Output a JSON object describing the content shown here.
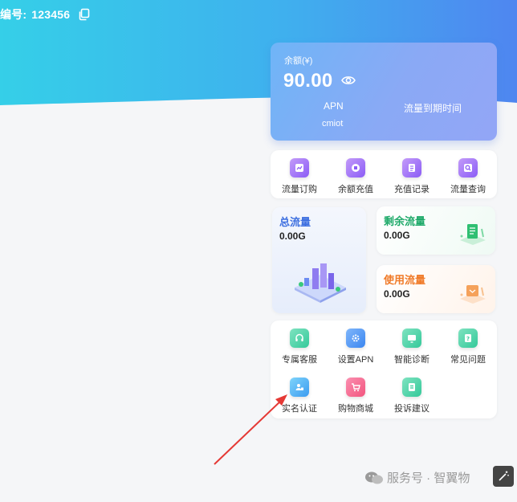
{
  "header": {
    "id_label": "编号:",
    "id_value": "123456"
  },
  "balance": {
    "label": "余额(¥)",
    "amount": "90.00",
    "apn_label": "APN",
    "apn_value": "cmiot",
    "expire_label": "流量到期时间"
  },
  "quick_actions": [
    {
      "label": "流量订购",
      "icon": "package-icon",
      "color": "#8b5cf6"
    },
    {
      "label": "余额充值",
      "icon": "wallet-icon",
      "color": "#8b5cf6"
    },
    {
      "label": "充值记录",
      "icon": "record-icon",
      "color": "#8b5cf6"
    },
    {
      "label": "流量查询",
      "icon": "search-icon",
      "color": "#8b5cf6"
    }
  ],
  "flow": {
    "total": {
      "title": "总流量",
      "value": "0.00G",
      "color": "#3d6fe0"
    },
    "remaining": {
      "title": "剩余流量",
      "value": "0.00G",
      "color": "#1faa6a"
    },
    "used": {
      "title": "使用流量",
      "value": "0.00G",
      "color": "#f07a28"
    }
  },
  "services": [
    {
      "label": "专属客服",
      "icon": "headset-icon",
      "color": "#34c99a"
    },
    {
      "label": "设置APN",
      "icon": "gear-icon",
      "color": "#3b86f0"
    },
    {
      "label": "智能诊断",
      "icon": "monitor-icon",
      "color": "#34c99a"
    },
    {
      "label": "常见问题",
      "icon": "question-icon",
      "color": "#34c99a"
    },
    {
      "label": "实名认证",
      "icon": "id-card-icon",
      "color": "#3b86f0"
    },
    {
      "label": "购物商城",
      "icon": "cart-icon",
      "color": "#f2557e"
    },
    {
      "label": "投诉建议",
      "icon": "feedback-icon",
      "color": "#34c99a"
    }
  ],
  "watermark": {
    "text": "服务号 · 智翼物"
  }
}
